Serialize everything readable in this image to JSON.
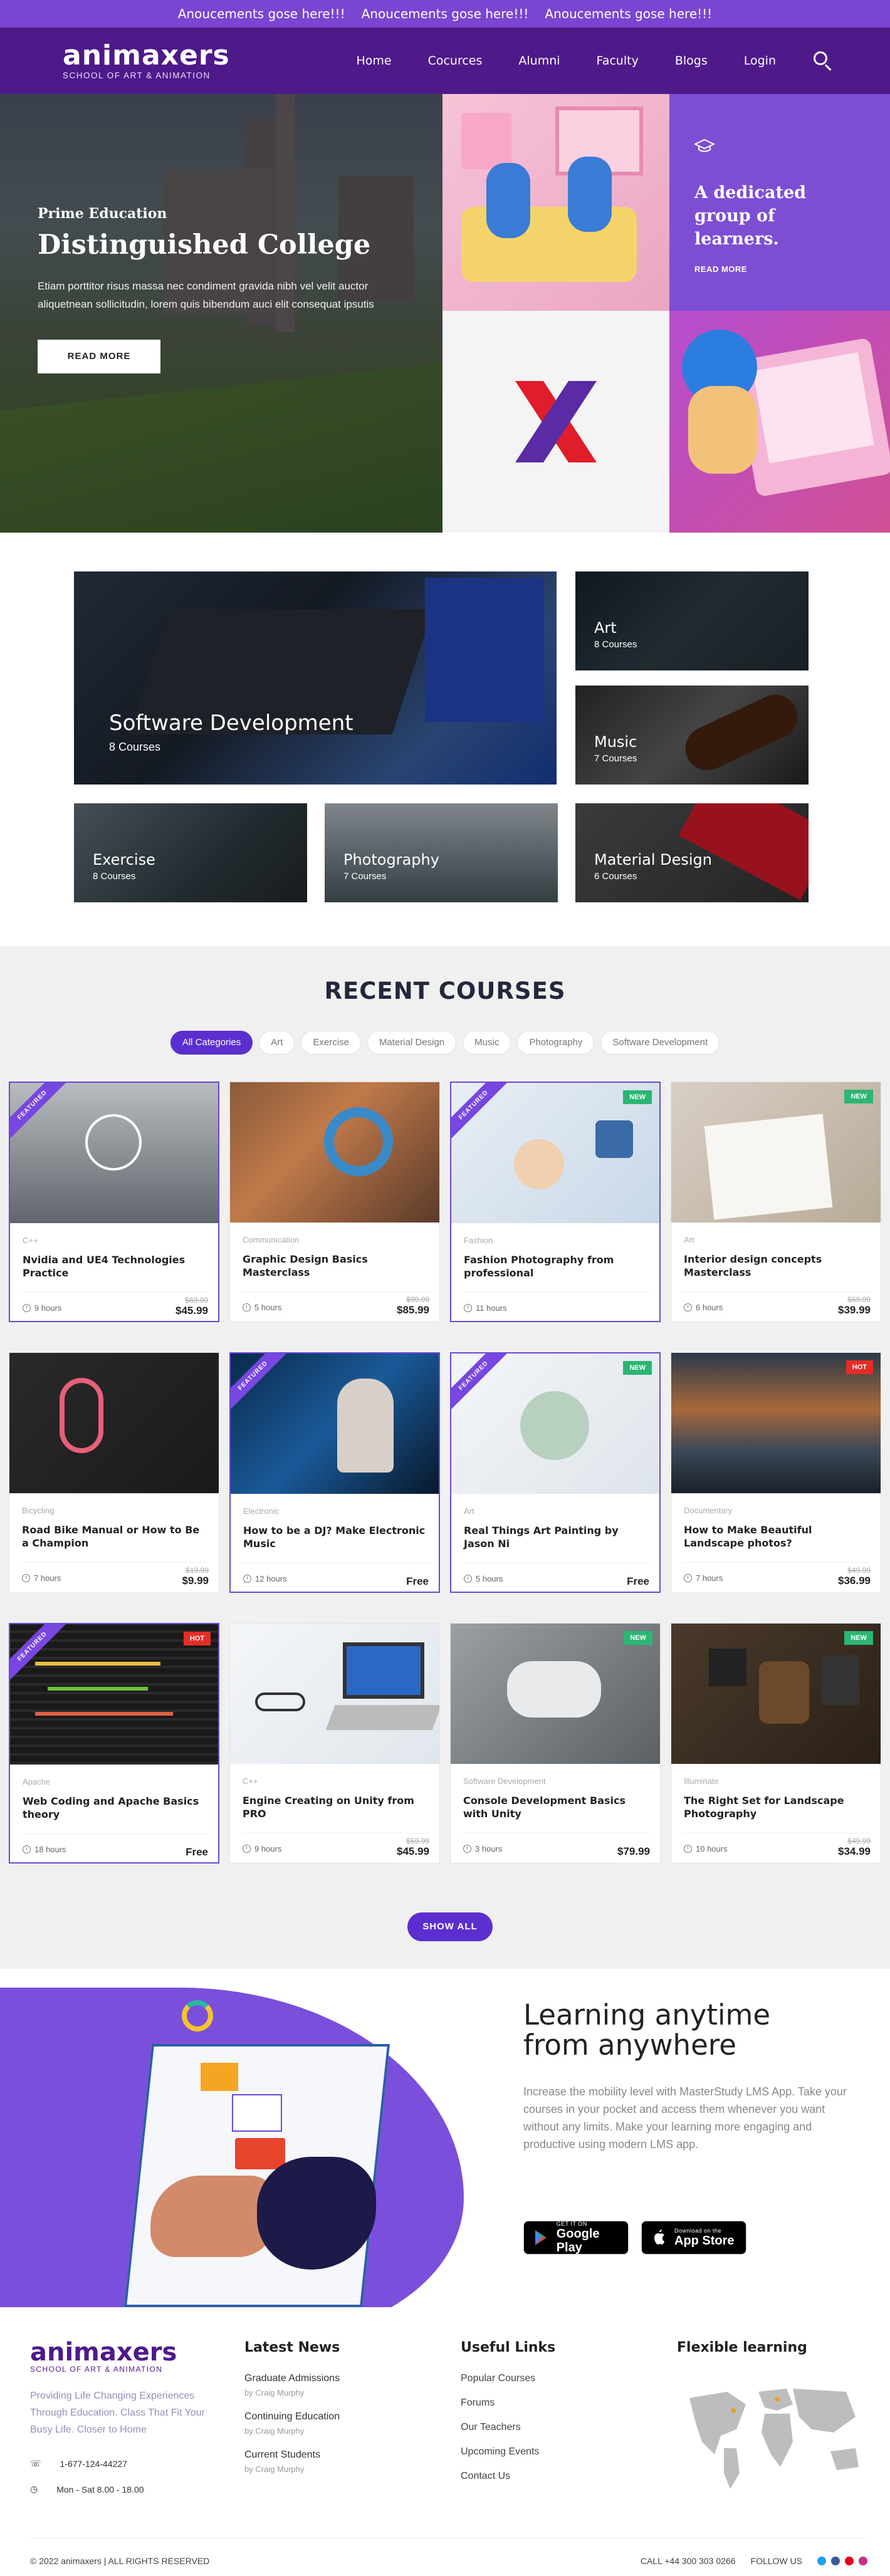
{
  "announcement": [
    "Anoucements gose here!!!",
    "Anoucements gose here!!!",
    "Anoucements gose here!!!"
  ],
  "header": {
    "logo": "animaxers",
    "logo_sub": "SCHOOL OF ART & ANIMATION",
    "nav": [
      "Home",
      "Cocurces",
      "Alumni",
      "Faculty",
      "Blogs",
      "Login"
    ],
    "icons": [
      "search-icon"
    ]
  },
  "hero": {
    "kicker": "Prime Education",
    "title": "Distinguished College",
    "text": "Etiam porttitor risus massa nec condiment gravida nibh vel velit auctor aliquetnean sollicitudin, lorem quis bibendum auci elit consequat ipsutis",
    "button": "READ MORE",
    "side_title": "A dedicated group of learners.",
    "side_link": "READ MORE",
    "colors": {
      "purple": "#7d4ed3",
      "logo_red": "#e01d2a",
      "logo_purple": "#5a2ba4"
    }
  },
  "categories": [
    {
      "title": "Software Development",
      "count": "8 Courses"
    },
    {
      "title": "Art",
      "count": "8 Courses"
    },
    {
      "title": "Music",
      "count": "7 Courses"
    },
    {
      "title": "Exercise",
      "count": "8 Courses"
    },
    {
      "title": "Photography",
      "count": "7 Courses"
    },
    {
      "title": "Material Design",
      "count": "6 Courses"
    }
  ],
  "recent": {
    "heading": "RECENT COURSES",
    "filters": [
      "All Categories",
      "Art",
      "Exercise",
      "Material Design",
      "Music",
      "Photography",
      "Software Development"
    ],
    "ribbon": "FEATURED",
    "courses": [
      {
        "category": "C++",
        "title": "Nvidia and UE4 Technologies Practice",
        "hours": "9 hours",
        "old": "$69.99",
        "price": "$45.99",
        "badge": ""
      },
      {
        "category": "Communication",
        "title": "Graphic Design Basics Masterclass",
        "hours": "5 hours",
        "old": "$99.99",
        "price": "$85.99",
        "badge": ""
      },
      {
        "category": "Fashion",
        "title": "Fashion Photography from professional",
        "hours": "11 hours",
        "old": "",
        "price": "",
        "badge": "NEW"
      },
      {
        "category": "Art",
        "title": "Interior design concepts Masterclass",
        "hours": "6 hours",
        "old": "$69.99",
        "price": "$39.99",
        "badge": "NEW"
      },
      {
        "category": "Bicycling",
        "title": "Road Bike Manual or How to Be a Champion",
        "hours": "7 hours",
        "old": "$19.99",
        "price": "$9.99",
        "badge": ""
      },
      {
        "category": "Electronic",
        "title": "How to be a DJ? Make Electronic Music",
        "hours": "12 hours",
        "old": "",
        "price": "Free",
        "badge": ""
      },
      {
        "category": "Art",
        "title": "Real Things Art Painting by Jason Ni",
        "hours": "5 hours",
        "old": "",
        "price": "Free",
        "badge": "NEW"
      },
      {
        "category": "Documentary",
        "title": "How to Make Beautiful Landscape photos?",
        "hours": "7 hours",
        "old": "$49.99",
        "price": "$36.99",
        "badge": "HOT"
      },
      {
        "category": "Apache",
        "title": "Web Coding and Apache Basics theory",
        "hours": "18 hours",
        "old": "",
        "price": "Free",
        "badge": "HOT"
      },
      {
        "category": "C++",
        "title": "Engine Creating on Unity from PRO",
        "hours": "9 hours",
        "old": "$59.99",
        "price": "$45.99",
        "badge": ""
      },
      {
        "category": "Software Development",
        "title": "Console Development Basics with Unity",
        "hours": "3 hours",
        "old": "",
        "price": "$79.99",
        "badge": "NEW"
      },
      {
        "category": "Illuminate",
        "title": "The Right Set for Landscape Photography",
        "hours": "10 hours",
        "old": "$49.99",
        "price": "$34.99",
        "badge": "NEW"
      }
    ],
    "show_all": "SHOW ALL"
  },
  "app": {
    "title_line1": "Learning anytime",
    "title_line2": "from anywhere",
    "text": "Increase the mobility level with MasterStudy LMS App. Take your courses in your pocket and access them whenever you want without any limits. Make your learning more engaging and productive using modern LMS app.",
    "google_small": "GET IT ON",
    "google_big": "Google Play",
    "apple_small": "Download on the",
    "apple_big": "App Store"
  },
  "footer": {
    "logo": "animaxers",
    "logo_sub": "SCHOOL OF ART & ANIMATION",
    "desc": "Providing Life Changing Experiences Through Education. Class That Fit Your Busy Life. Closer to Home",
    "phone": "1-677-124-44227",
    "hours": "Mon - Sat 8.00 - 18.00",
    "news_title": "Latest News",
    "news": [
      {
        "title": "Graduate Admissions",
        "by": "by Craig Murphy"
      },
      {
        "title": "Continuing Education",
        "by": "by Craig Murphy"
      },
      {
        "title": "Current Students",
        "by": "by Craig Murphy"
      }
    ],
    "links_title": "Useful Links",
    "links": [
      "Popular Courses",
      "Forums",
      "Our Teachers",
      "Upcoming Events",
      "Contact Us"
    ],
    "flex_title": "Flexible learning",
    "copyright": "© 2022 animaxers | ALL RIGHTS RESERVED",
    "call": "CALL +44 300 303 0266",
    "follow": "FOLLOW US"
  }
}
